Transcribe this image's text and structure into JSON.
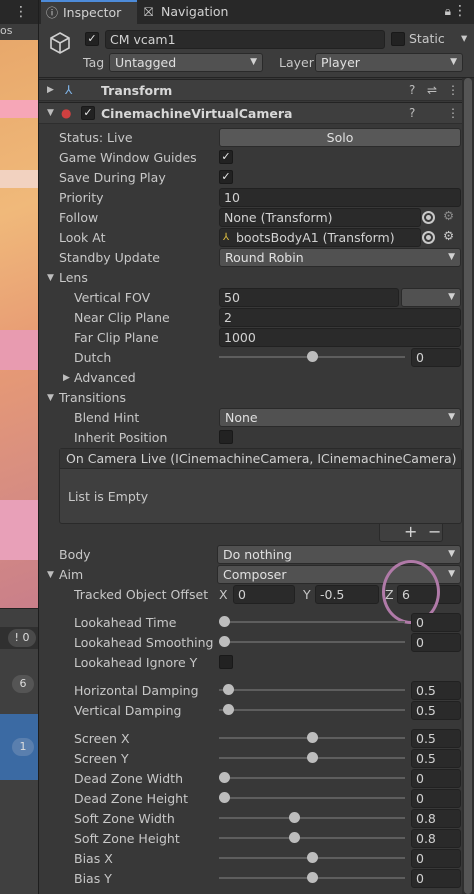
{
  "left_panel": {
    "toolbar_text": "os",
    "counter_badge": "0",
    "badge_6": "6",
    "badge_1": "1"
  },
  "tabs": [
    {
      "label": "Inspector",
      "icon": "info-icon"
    },
    {
      "label": "Navigation",
      "icon": "navigation-icon"
    }
  ],
  "header": {
    "object_name": "CM vcam1",
    "active": true,
    "static_label": "Static",
    "static_checked": false,
    "tag_label": "Tag",
    "tag_value": "Untagged",
    "layer_label": "Layer",
    "layer_value": "Player"
  },
  "transform": {
    "title": "Transform"
  },
  "cinemachine": {
    "title": "CinemachineVirtualCamera",
    "enabled": true,
    "status_label": "Status: Live",
    "solo_label": "Solo",
    "game_window_guides_label": "Game Window Guides",
    "game_window_guides": true,
    "save_during_play_label": "Save During Play",
    "save_during_play": true,
    "priority_label": "Priority",
    "priority_value": "10",
    "follow_label": "Follow",
    "follow_value": "None (Transform)",
    "look_at_label": "Look At",
    "look_at_value": "bootsBodyA1 (Transform)",
    "standby_update_label": "Standby Update",
    "standby_update_value": "Round Robin",
    "lens": {
      "label": "Lens",
      "vertical_fov_label": "Vertical FOV",
      "vertical_fov_value": "50",
      "near_clip_label": "Near Clip Plane",
      "near_clip_value": "2",
      "far_clip_label": "Far Clip Plane",
      "far_clip_value": "1000",
      "dutch_label": "Dutch",
      "dutch_value": "0",
      "dutch_fraction": 0.5,
      "advanced_label": "Advanced"
    },
    "transitions": {
      "label": "Transitions",
      "blend_hint_label": "Blend Hint",
      "blend_hint_value": "None",
      "inherit_position_label": "Inherit Position",
      "inherit_position": false,
      "event_title": "On Camera Live (ICinemachineCamera, ICinemachineCamera)",
      "event_empty": "List is Empty",
      "add_label": "+",
      "remove_label": "−"
    },
    "body_label": "Body",
    "body_value": "Do nothing",
    "aim": {
      "label": "Aim",
      "value": "Composer",
      "tracked_offset_label": "Tracked Object Offset",
      "x_label": "X",
      "x_value": "0",
      "y_label": "Y",
      "y_value": "-0.5",
      "z_label": "Z",
      "z_value": "6",
      "lookahead_time_label": "Lookahead Time",
      "lookahead_time_value": "0",
      "lookahead_time_fraction": 0.0,
      "lookahead_smoothing_label": "Lookahead Smoothing",
      "lookahead_smoothing_value": "0",
      "lookahead_smoothing_fraction": 0.0,
      "lookahead_ignore_y_label": "Lookahead Ignore Y",
      "lookahead_ignore_y": false,
      "horizontal_damping_label": "Horizontal Damping",
      "horizontal_damping_value": "0.5",
      "horizontal_damping_fraction": 0.025,
      "vertical_damping_label": "Vertical Damping",
      "vertical_damping_value": "0.5",
      "vertical_damping_fraction": 0.025,
      "screen_x_label": "Screen X",
      "screen_x_value": "0.5",
      "screen_x_fraction": 0.5,
      "screen_y_label": "Screen Y",
      "screen_y_value": "0.5",
      "screen_y_fraction": 0.5,
      "dead_zone_width_label": "Dead Zone Width",
      "dead_zone_width_value": "0",
      "dead_zone_width_fraction": 0.0,
      "dead_zone_height_label": "Dead Zone Height",
      "dead_zone_height_value": "0",
      "dead_zone_height_fraction": 0.0,
      "soft_zone_width_label": "Soft Zone Width",
      "soft_zone_width_value": "0.8",
      "soft_zone_width_fraction": 0.4,
      "soft_zone_height_label": "Soft Zone Height",
      "soft_zone_height_value": "0.8",
      "soft_zone_height_fraction": 0.4,
      "bias_x_label": "Bias X",
      "bias_x_value": "0",
      "bias_x_fraction": 0.5,
      "bias_y_label": "Bias Y",
      "bias_y_value": "0",
      "bias_y_fraction": 0.5
    }
  },
  "colors": {
    "panel_bg": "#383838",
    "accent_tab": "#4d8bd9",
    "highlight_circle": "#b07aa8"
  }
}
